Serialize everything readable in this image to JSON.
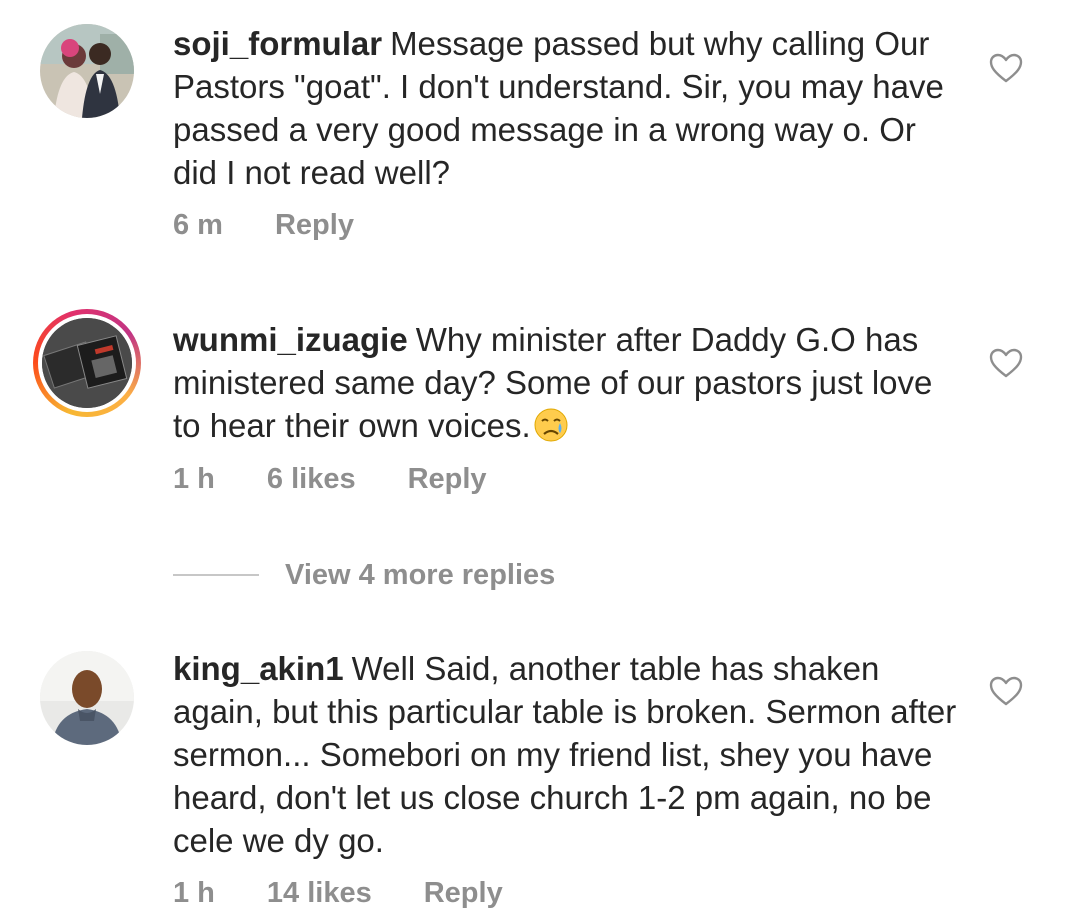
{
  "comments": [
    {
      "username": "soji_formular",
      "text": "Message passed but why calling Our Pastors \"goat\". I don't understand. Sir, you may have passed a very good message in a wrong way o. Or did I not read well?",
      "time": "6 m",
      "likes": "",
      "reply_label": "Reply",
      "avatar_icon": "couple-photo",
      "has_story_ring": false
    },
    {
      "username": "wunmi_izuagie",
      "text": "Why minister after Daddy G.O has ministered same day? Some of our pastors just love to hear their own voices.",
      "emoji": "crying-face-emoji",
      "time": "1 h",
      "likes": "6 likes",
      "reply_label": "Reply",
      "avatar_icon": "book-cover-photo",
      "has_story_ring": true
    },
    {
      "username": "king_akin1",
      "text": "Well Said, another table has shaken again, but this particular table is broken. Sermon after sermon... Somebori on my friend list, shey you have heard, don't let us close church 1-2 pm again, no be cele we dy go.",
      "time": "1 h",
      "likes": "14 likes",
      "reply_label": "Reply",
      "avatar_icon": "man-portrait-photo",
      "has_story_ring": false
    }
  ],
  "view_more_replies": "View 4 more replies",
  "colors": {
    "text": "#262626",
    "meta": "#8e8e8e",
    "divider": "#c7c7c7"
  }
}
